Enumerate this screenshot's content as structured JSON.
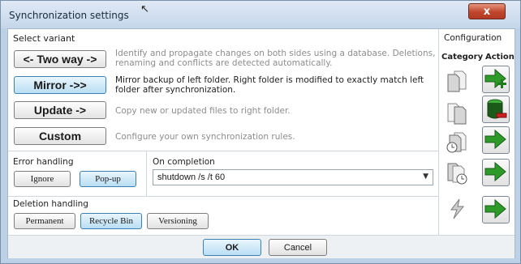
{
  "window": {
    "title": "Synchronization settings",
    "close_glyph": "x"
  },
  "variant": {
    "heading": "Select variant",
    "options": [
      {
        "label": "<- Two way ->",
        "description": "Identify and propagate changes on both sides using a database. Deletions, renaming and conflicts are detected automatically.",
        "selected": false
      },
      {
        "label": "Mirror ->>",
        "description": "Mirror backup of left folder. Right folder is modified to exactly match left folder after synchronization.",
        "selected": true
      },
      {
        "label": "Update ->",
        "description": "Copy new or updated files to right folder.",
        "selected": false
      },
      {
        "label": "Custom",
        "description": "Configure your own synchronization rules.",
        "selected": false
      }
    ]
  },
  "error_handling": {
    "heading": "Error handling",
    "options": [
      {
        "label": "Ignore",
        "selected": false
      },
      {
        "label": "Pop-up",
        "selected": true
      }
    ]
  },
  "on_completion": {
    "heading": "On completion",
    "value": "shutdown /s /t 60"
  },
  "deletion_handling": {
    "heading": "Deletion handling",
    "options": [
      {
        "label": "Permanent",
        "selected": false
      },
      {
        "label": "Recycle Bin",
        "selected": true
      },
      {
        "label": "Versioning",
        "selected": false
      }
    ]
  },
  "configuration": {
    "heading": "Configuration",
    "category_label": "Category",
    "action_label": "Action",
    "rows": [
      {
        "category_icon": "file-exists-left-only-icon",
        "action_icon": "create-right-icon"
      },
      {
        "category_icon": "file-exists-right-only-icon",
        "action_icon": "delete-right-icon"
      },
      {
        "category_icon": "left-newer-icon",
        "action_icon": "overwrite-right-icon"
      },
      {
        "category_icon": "right-newer-icon",
        "action_icon": "overwrite-right-icon"
      },
      {
        "category_icon": "different-content-icon",
        "action_icon": "overwrite-right-icon"
      }
    ]
  },
  "buttons": {
    "ok": "OK",
    "cancel": "Cancel"
  },
  "colors": {
    "selected_fill": "#b9def3",
    "action_green": "#2e9a2a",
    "delete_red": "#cc2020"
  }
}
